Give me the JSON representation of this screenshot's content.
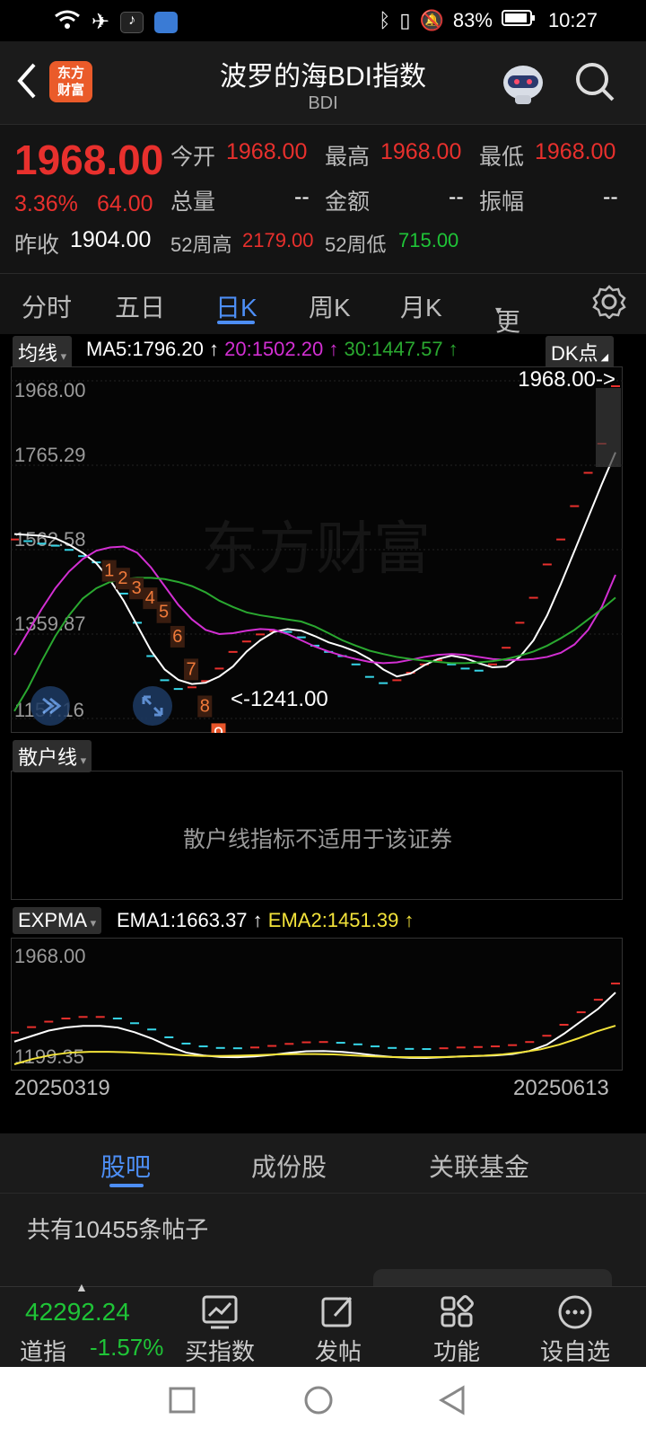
{
  "status": {
    "battery": "83%",
    "time": "10:27"
  },
  "header": {
    "logo_line1": "东方",
    "logo_line2": "财富",
    "title": "波罗的海BDI指数",
    "subtitle": "BDI"
  },
  "quote": {
    "price": "1968.00",
    "change_pct": "3.36%",
    "change_abs": "64.00",
    "prev_close_label": "昨收",
    "prev_close": "1904.00",
    "open_label": "今开",
    "open": "1968.00",
    "high_label": "最高",
    "high": "1968.00",
    "low_label": "最低",
    "low": "1968.00",
    "volume_label": "总量",
    "volume": "--",
    "amount_label": "金额",
    "amount": "--",
    "amplitude_label": "振幅",
    "amplitude": "--",
    "wk52_high_label": "52周高",
    "wk52_high": "2179.00",
    "wk52_low_label": "52周低",
    "wk52_low": "715.00"
  },
  "ktabs": [
    "分时",
    "五日",
    "日K",
    "周K",
    "月K",
    "更多"
  ],
  "ktabs_active": "日K",
  "main_chart": {
    "indicator": "均线",
    "ma5": "MA5:1796.20",
    "ma20": "20:1502.20",
    "ma30": "30:1447.57",
    "dk_label": "DK点",
    "y_labels": [
      "1968.00",
      "1765.29",
      "1562.58",
      "1359.87",
      "1157.16"
    ],
    "last_mark": "1968.00->",
    "low_mark": "<-1241.00",
    "watermark": "东方财富",
    "colors": {
      "ma5": "#ffffff",
      "ma20": "#d22fd2",
      "ma30": "#2aa830",
      "up": "#e8302d",
      "down": "#37d6e8"
    }
  },
  "retail_panel": {
    "indicator": "散户线",
    "message": "散户线指标不适用于该证券"
  },
  "expma": {
    "indicator": "EXPMA",
    "ema1": "EMA1:1663.37",
    "ema2": "EMA2:1451.39",
    "y_labels": [
      "1968.00",
      "1199.35"
    ],
    "date_start": "20250319",
    "date_end": "20250613"
  },
  "chart_data": [
    {
      "type": "line",
      "title": "",
      "ylim": [
        1157.16,
        1968.0
      ],
      "series": [
        {
          "name": "MA5",
          "values": [
            1600,
            1598,
            1596,
            1590,
            1575,
            1555,
            1530,
            1490,
            1440,
            1380,
            1320,
            1275,
            1250,
            1240,
            1243,
            1258,
            1282,
            1318,
            1345,
            1365,
            1372,
            1368,
            1355,
            1340,
            1330,
            1318,
            1300,
            1275,
            1258,
            1265,
            1285,
            1300,
            1308,
            1302,
            1290,
            1280,
            1282,
            1305,
            1345,
            1405,
            1480,
            1560,
            1640,
            1720,
            1796.2
          ]
        },
        {
          "name": "20",
          "values": [
            1310,
            1365,
            1420,
            1470,
            1510,
            1540,
            1560,
            1568,
            1570,
            1555,
            1520,
            1475,
            1430,
            1395,
            1370,
            1360,
            1362,
            1368,
            1372,
            1370,
            1360,
            1345,
            1330,
            1318,
            1308,
            1300,
            1293,
            1290,
            1292,
            1298,
            1305,
            1310,
            1312,
            1310,
            1305,
            1300,
            1298,
            1298,
            1300,
            1305,
            1315,
            1335,
            1370,
            1425,
            1502.2
          ]
        },
        {
          "name": "30",
          "values": [
            1175,
            1230,
            1295,
            1355,
            1405,
            1445,
            1470,
            1485,
            1492,
            1495,
            1495,
            1492,
            1485,
            1475,
            1460,
            1440,
            1425,
            1412,
            1405,
            1400,
            1395,
            1390,
            1378,
            1362,
            1345,
            1332,
            1320,
            1312,
            1305,
            1300,
            1296,
            1293,
            1290,
            1290,
            1292,
            1295,
            1300,
            1308,
            1318,
            1332,
            1350,
            1370,
            1395,
            1420,
            1447.57
          ]
        },
        {
          "name": "DK",
          "values": [
            1600,
            1596,
            1590,
            1585,
            1575,
            1560,
            1545,
            1520,
            1470,
            1400,
            1320,
            1262,
            1241,
            1245,
            1260,
            1290,
            1330,
            1355,
            1372,
            1380,
            1378,
            1365,
            1345,
            1330,
            1320,
            1300,
            1270,
            1255,
            1262,
            1280,
            1300,
            1310,
            1300,
            1290,
            1285,
            1300,
            1340,
            1400,
            1460,
            1540,
            1600,
            1680,
            1760,
            1830,
            1968.0
          ]
        }
      ]
    },
    {
      "type": "line",
      "title": "",
      "ylim": [
        1199.35,
        1968.0
      ],
      "x": [
        "20250319",
        "20250613"
      ],
      "series": [
        {
          "name": "EMA1",
          "values": [
            1350,
            1385,
            1420,
            1440,
            1450,
            1450,
            1440,
            1410,
            1370,
            1320,
            1280,
            1262,
            1252,
            1250,
            1255,
            1265,
            1278,
            1288,
            1290,
            1285,
            1275,
            1262,
            1252,
            1246,
            1245,
            1250,
            1255,
            1258,
            1262,
            1270,
            1290,
            1330,
            1400,
            1480,
            1560,
            1663.37
          ]
        },
        {
          "name": "EMA2",
          "values": [
            1205,
            1240,
            1265,
            1280,
            1285,
            1285,
            1282,
            1276,
            1270,
            1263,
            1258,
            1258,
            1260,
            1264,
            1268,
            1270,
            1270,
            1268,
            1262,
            1256,
            1252,
            1250,
            1250,
            1252,
            1256,
            1260,
            1268,
            1282,
            1300,
            1330,
            1370,
            1415,
            1451.39
          ]
        }
      ]
    }
  ],
  "sections": {
    "tabs": [
      "股吧",
      "成份股",
      "关联基金"
    ],
    "active": "股吧",
    "post_count": "共有10455条帖子"
  },
  "bottom": {
    "index_value": "42292.24",
    "index_name": "道指",
    "index_change": "-1.57%",
    "buttons": [
      "买指数",
      "发帖",
      "功能",
      "设自选"
    ]
  }
}
